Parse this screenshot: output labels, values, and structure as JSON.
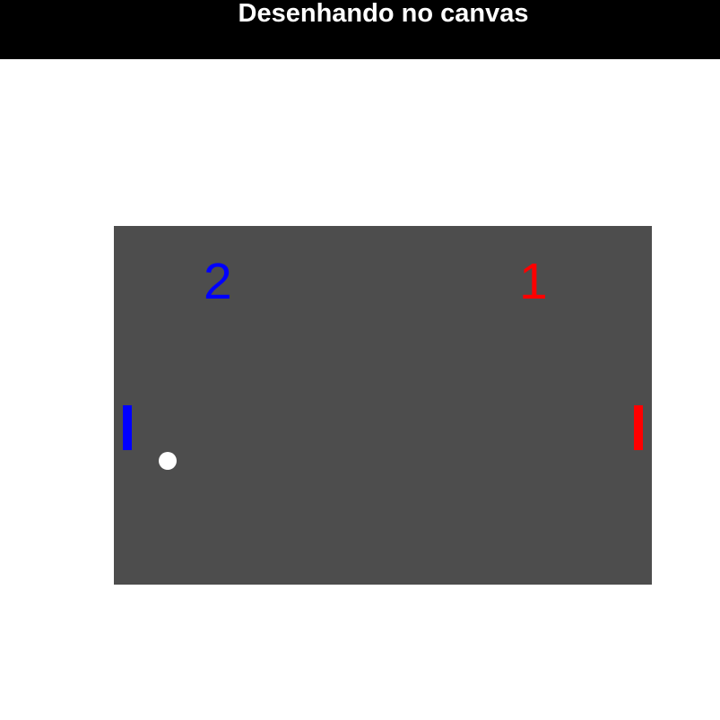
{
  "header": {
    "title": "Desenhando no canvas"
  },
  "game": {
    "background_color": "#4d4d4d",
    "left_player": {
      "score": "2",
      "color": "#0000ff"
    },
    "right_player": {
      "score": "1",
      "color": "#ff0000"
    },
    "ball": {
      "color": "#ffffff"
    }
  }
}
